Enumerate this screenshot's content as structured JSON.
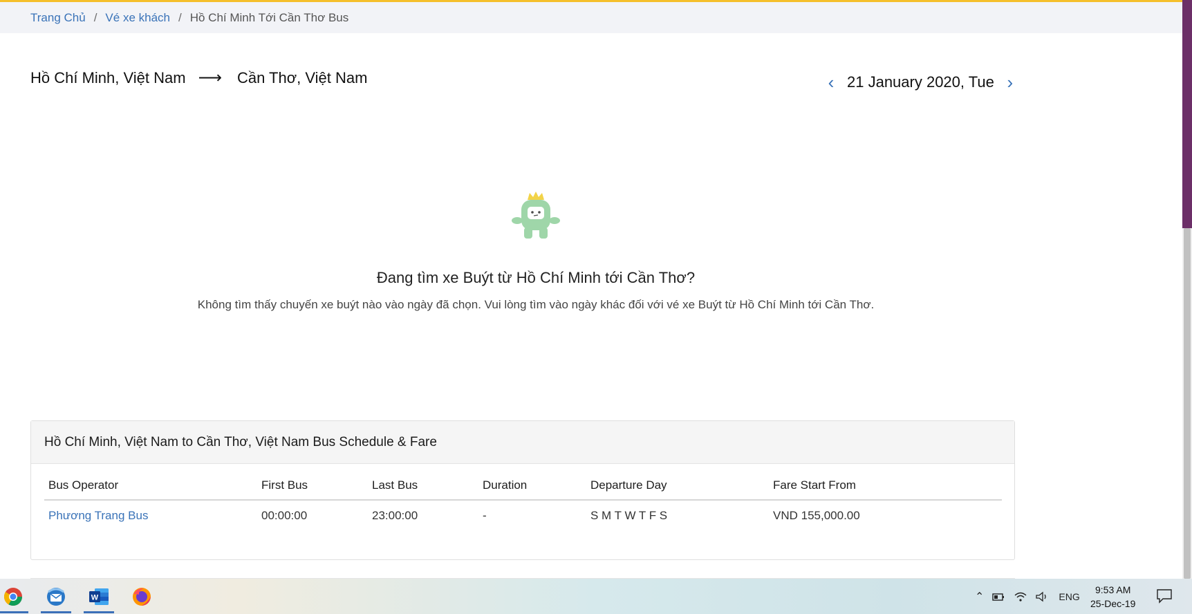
{
  "breadcrumb": {
    "home": "Trang Chủ",
    "section": "Vé xe khách",
    "current": "Hồ Chí Minh Tới Cần Thơ Bus",
    "separator": "/"
  },
  "route": {
    "from": "Hồ Chí Minh, Việt Nam",
    "arrow": "⟶",
    "to": "Cần Thơ, Việt Nam"
  },
  "date_nav": {
    "prev": "‹",
    "date": "21 January 2020, Tue",
    "next": "›"
  },
  "empty_state": {
    "title": "Đang tìm xe Buýt từ Hồ Chí Minh tới Cần Thơ?",
    "description": "Không tìm thấy chuyến xe buýt nào vào ngày đã chọn. Vui lòng tìm vào ngày khác đối với vé xe Buýt từ Hồ Chí Minh tới Cần Thơ."
  },
  "schedule": {
    "title": "Hồ Chí Minh, Việt Nam to Cần Thơ, Việt Nam Bus Schedule & Fare",
    "columns": [
      "Bus Operator",
      "First Bus",
      "Last Bus",
      "Duration",
      "Departure Day",
      "Fare Start From"
    ],
    "rows": [
      {
        "operator": "Phương Trang Bus",
        "first_bus": "00:00:00",
        "last_bus": "23:00:00",
        "duration": "-",
        "departure_day": "S M T W T F S",
        "fare": "VND 155,000.00"
      }
    ]
  },
  "taskbar": {
    "apps": [
      "chrome-icon",
      "thunderbird-icon",
      "word-icon",
      "firefox-icon"
    ],
    "tray_language": "ENG",
    "time": "9:53 AM",
    "date": "25-Dec-19"
  },
  "colors": {
    "accent_top": "#f5bf2b",
    "link": "#3a73b8",
    "scroll_accent": "#6c2f68"
  }
}
